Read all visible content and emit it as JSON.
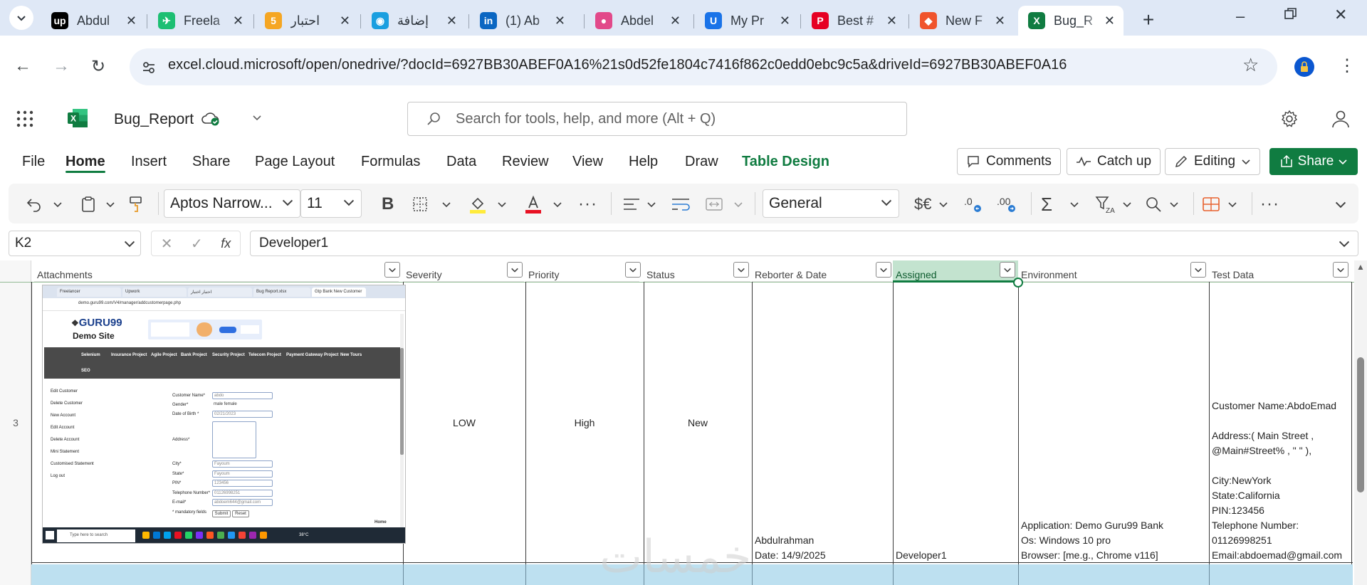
{
  "browser": {
    "tabs": [
      {
        "title": "Abdul",
        "fav_text": "up",
        "fav_color": "#000000"
      },
      {
        "title": "Freela",
        "fav_text": "✈",
        "fav_color": "#1dbf73"
      },
      {
        "title": "احتبار",
        "fav_text": "5",
        "fav_color": "#f5a623"
      },
      {
        "title": "إضافة",
        "fav_text": "◉",
        "fav_color": "#1a9fe0"
      },
      {
        "title": "(1) Ab",
        "fav_text": "in",
        "fav_color": "#0a66c2"
      },
      {
        "title": "Abdel",
        "fav_text": "●",
        "fav_color": "#e2498a"
      },
      {
        "title": "My Pr",
        "fav_text": "U",
        "fav_color": "#1a73e8"
      },
      {
        "title": "Best #",
        "fav_text": "P",
        "fav_color": "#e60023"
      },
      {
        "title": "New F",
        "fav_text": "◆",
        "fav_color": "#f0542c"
      },
      {
        "title": "Bug_R",
        "fav_text": "X",
        "fav_color": "#107c41"
      }
    ],
    "url": "excel.cloud.microsoft/open/onedrive/?docId=6927BB30ABEF0A16%21s0d52fe1804c7416f862c0edd0ebc9c5a&driveId=6927BB30ABEF0A16"
  },
  "excel": {
    "doc_name": "Bug_Report",
    "search_placeholder": "Search for tools, help, and more (Alt + Q)",
    "ribbon_tabs": [
      "File",
      "Home",
      "Insert",
      "Share",
      "Page Layout",
      "Formulas",
      "Data",
      "Review",
      "View",
      "Help",
      "Draw",
      "Table Design"
    ],
    "comments_label": "Comments",
    "catchup_label": "Catch up",
    "editing_label": "Editing",
    "share_label": "Share",
    "font_name": "Aptos Narrow...",
    "font_size": "11",
    "number_format": "General",
    "currency_symbol": "$€",
    "name_box": "K2",
    "fx_label": "fx",
    "formula_value": "Developer1"
  },
  "sheet": {
    "columns": [
      "Attachments",
      "Severity",
      "Priority",
      "Status",
      "Reborter & Date",
      "Assigned",
      "Environment",
      "Test Data"
    ],
    "row_number": "3",
    "row": {
      "severity": "LOW",
      "priority": "High",
      "status": "New",
      "reporter": "Abdulrahman\nDate: 14/9/2025",
      "assigned": "Developer1",
      "environment": "Application: Demo Guru99 Bank\nOs: Windows 10 pro\nBrowser: [me.g., Chrome v116]",
      "test_data": "Customer Name:AbdoEmad\n\nAddress:( Main Street ,\n@Main#Street% , \" \" ),\n\nCity:NewYork\nState:California\nPIN:123456\nTelephone Number:\n01126998251\nEmail:abdoemad@gmail.com"
    },
    "watermark": "خمسات"
  },
  "attachment": {
    "tabs": [
      "Freelancer",
      "Upwork",
      "احتبار اختبار",
      "Bug Report.xlsx",
      "Gtp Bank New Customer"
    ],
    "url": "demo.guru99.com/V4/manager/addcustomerpage.php",
    "logo": "GURU99",
    "logo_sub": "Demo Site",
    "menu": [
      "Selenium",
      "Insurance Project",
      "Agile Project",
      "Bank Project",
      "Security Project",
      "Telecom Project",
      "Payment Gateway Project",
      "New Tours"
    ],
    "menu2": "SEO",
    "side": [
      "Edit Customer",
      "Delete Customer",
      "New Account",
      "Edit Account",
      "Delete Account",
      "Mini Statement",
      "Customised Statement",
      "Log out"
    ],
    "labels": [
      "Customer Name*",
      "Gender*",
      "Date of Birth *",
      "Address*",
      "City*",
      "State*",
      "PIN*",
      "Telephone Number*",
      "E-mail*",
      "* mandatory fields"
    ],
    "values": [
      "abdo",
      "male  female",
      "02/21/2023",
      "",
      "Fayoum",
      "Fayoum",
      "123456",
      "01126998251",
      "abdoem644@gmail.com"
    ],
    "buttons": [
      "Submit",
      "Reset"
    ],
    "home": "Home",
    "taskbar_search": "Type here to search",
    "temp": "38°C"
  }
}
